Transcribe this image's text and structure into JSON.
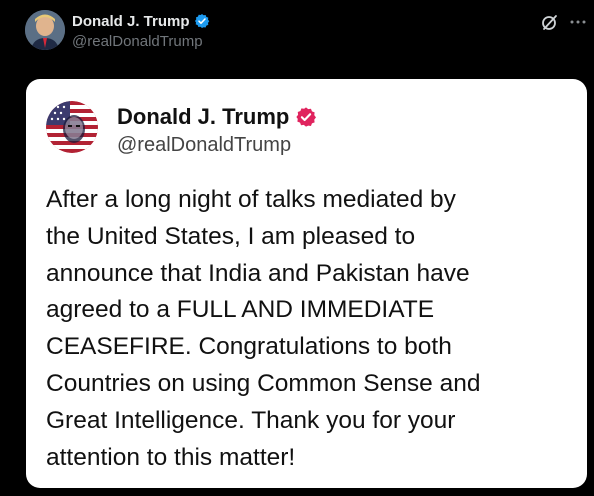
{
  "post": {
    "author_name": "Donald J. Trump",
    "author_handle": "@realDonaldTrump",
    "verified": true,
    "icons": {
      "verified_small": "verified-badge-icon",
      "grok": "grok-icon",
      "more": "more-options-icon"
    },
    "colors": {
      "background": "#000000",
      "name_text": "#e7e9ea",
      "handle_text": "#71767b",
      "verified_blue": "#1d9bf0"
    }
  },
  "embedded_card": {
    "author_name": "Donald J. Trump",
    "author_handle": "@realDonaldTrump",
    "verified": true,
    "verified_color": "#e0245e",
    "text": "After a long night of talks mediated by\nthe United States, I am pleased to\nannounce that India and Pakistan have\nagreed to a FULL AND IMMEDIATE\nCEASEFIRE. Congratulations to both\nCountries on using Common Sense and\nGreat Intelligence. Thank you for your\nattention to this matter!"
  }
}
